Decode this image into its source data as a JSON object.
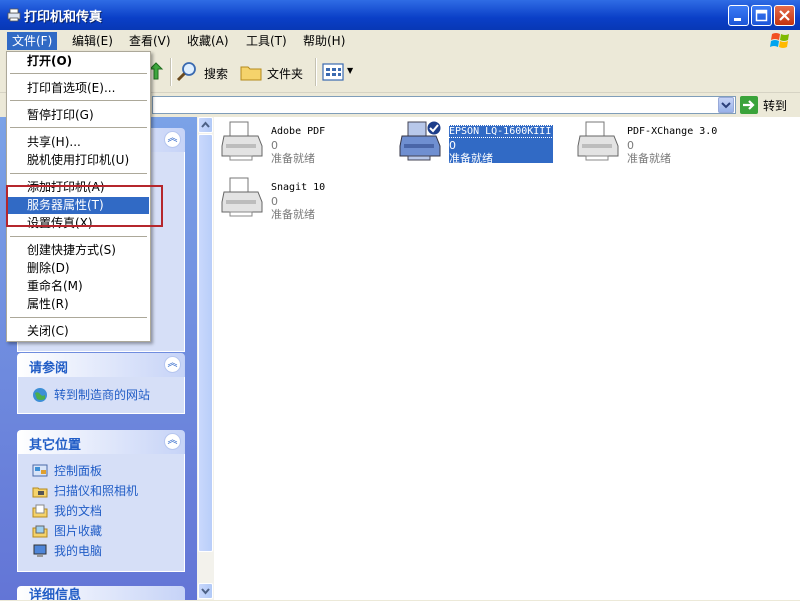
{
  "window": {
    "title": "打印机和传真"
  },
  "menubar": {
    "items": [
      "文件(F)",
      "编辑(E)",
      "查看(V)",
      "收藏(A)",
      "工具(T)",
      "帮助(H)"
    ]
  },
  "toolbar": {
    "search": "搜索",
    "folders": "文件夹"
  },
  "address": {
    "go": "转到"
  },
  "file_menu": {
    "items": [
      "打开(O)",
      "打印首选项(E)...",
      "暂停打印(G)",
      "共享(H)...",
      "脱机使用打印机(U)",
      "添加打印机(A)",
      "服务器属性(T)",
      "设置传真(X)",
      "创建快捷方式(S)",
      "删除(D)",
      "重命名(M)",
      "属性(R)",
      "关闭(C)"
    ]
  },
  "left_panels": {
    "see_also": {
      "title": "请参阅",
      "links": [
        "转到制造商的网站"
      ]
    },
    "other_places": {
      "title": "其它位置",
      "links": [
        "控制面板",
        "扫描仪和照相机",
        "我的文档",
        "图片收藏",
        "我的电脑"
      ]
    },
    "details_partial": "详细信息"
  },
  "printers": [
    {
      "name": "Adobe PDF",
      "count": "0",
      "status": "准备就绪"
    },
    {
      "name": "EPSON LQ-1600KIII",
      "count": "0",
      "status": "准备就绪"
    },
    {
      "name": "PDF-XChange 3.0",
      "count": "0",
      "status": "准备就绪"
    },
    {
      "name": "Snagit 10",
      "count": "0",
      "status": "准备就绪"
    }
  ],
  "colors": {
    "titlebar": "#0A3FC7",
    "menu_highlight": "#316AC5",
    "panel_link": "#215DC6",
    "annotation_box": "#B5262C"
  }
}
